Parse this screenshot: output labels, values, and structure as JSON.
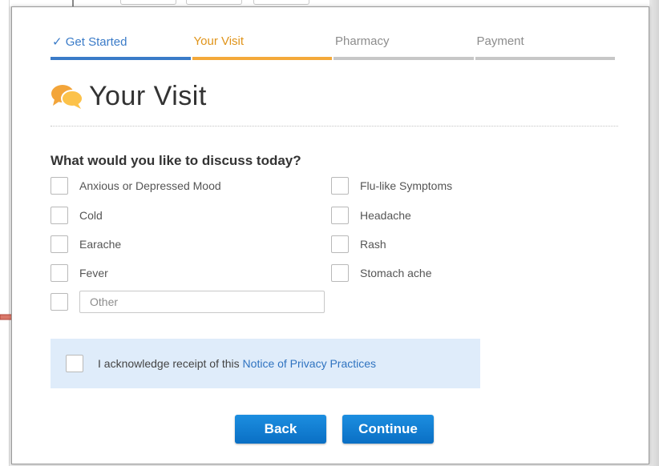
{
  "steps": [
    {
      "label": "✓ Get Started",
      "state": "done"
    },
    {
      "label": "Your Visit",
      "state": "current"
    },
    {
      "label": "Pharmacy",
      "state": "todo"
    },
    {
      "label": "Payment",
      "state": "todo"
    }
  ],
  "page": {
    "title": "Your Visit",
    "question": "What would you like to discuss today?"
  },
  "options": {
    "left": [
      "Anxious or Depressed Mood",
      "Cold",
      "Earache",
      "Fever"
    ],
    "right": [
      "Flu-like Symptoms",
      "Headache",
      "Rash",
      "Stomach ache"
    ]
  },
  "other": {
    "placeholder": "Other",
    "value": ""
  },
  "privacy": {
    "text": "I acknowledge receipt of this ",
    "link": "Notice of Privacy Practices"
  },
  "buttons": {
    "back": "Back",
    "continue": "Continue"
  },
  "colors": {
    "step_done": "#3a7bc8",
    "step_current": "#f4a93a",
    "step_todo": "#c7c7c7",
    "primary_button": "#1580d4",
    "privacy_bg": "#dfecfa",
    "arrow": "#c0392b"
  },
  "icons": {
    "title_icon": "chat-bubbles-icon",
    "annotation": "arrow-right-icon"
  }
}
